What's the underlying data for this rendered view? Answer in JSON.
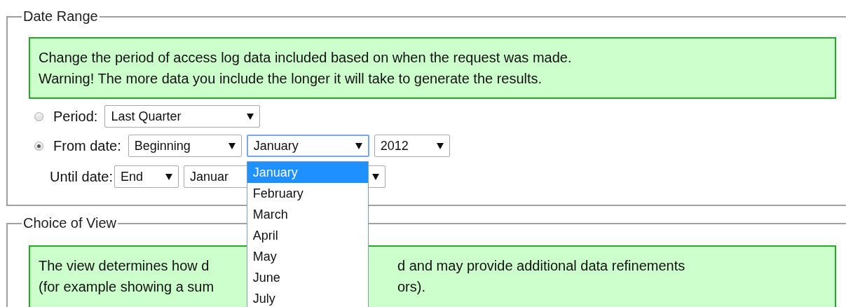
{
  "date_range": {
    "legend": "Date Range",
    "info": [
      "Change the period of access log data included based on when the request was made.",
      "Warning! The more data you include the longer it will take to generate the results."
    ],
    "period": {
      "label": "Period:",
      "selected": false,
      "value": "Last Quarter"
    },
    "from_date": {
      "label": "From date:",
      "selected": true,
      "start": "Beginning",
      "month": "January",
      "year": "2012"
    },
    "until_date": {
      "label": "Until date:",
      "end": "End",
      "month": "Januar"
    },
    "month_options": [
      {
        "label": "January",
        "selected": true
      },
      {
        "label": "February",
        "selected": false
      },
      {
        "label": "March",
        "selected": false
      },
      {
        "label": "April",
        "selected": false
      },
      {
        "label": "May",
        "selected": false
      },
      {
        "label": "June",
        "selected": false
      },
      {
        "label": "July",
        "selected": false
      }
    ]
  },
  "choice_of_view": {
    "legend": "Choice of View",
    "info": [
      {
        "left": "The view determines how d",
        "right": "d and may provide additional data refinements"
      },
      {
        "left": "(for example showing a sum",
        "right": "ors)."
      }
    ]
  }
}
